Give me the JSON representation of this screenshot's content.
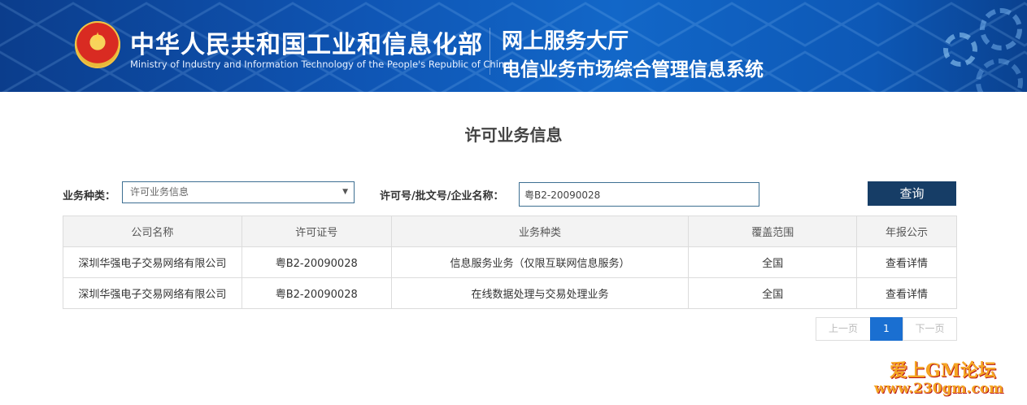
{
  "header": {
    "ministry_cn": "中华人民共和国工业和信息化部",
    "ministry_en": "Ministry of Industry and Information Technology of the People's Republic of China",
    "hall": "网上服务大厅",
    "system": "电信业务市场综合管理信息系统",
    "brand_color": "#0f55b4"
  },
  "page_title": "许可业务信息",
  "search": {
    "category_label": "业务种类：",
    "category_value": "许可业务信息",
    "keyword_label": "许可号/批文号/企业名称：",
    "keyword_value": "粤B2-20090028",
    "query_button": "查询",
    "button_color": "#163d66"
  },
  "table": {
    "headers": [
      "公司名称",
      "许可证号",
      "业务种类",
      "覆盖范围",
      "年报公示"
    ],
    "rows": [
      {
        "company": "深圳华强电子交易网络有限公司",
        "license": "粤B2-20090028",
        "business": "信息服务业务（仅限互联网信息服务）",
        "coverage": "全国",
        "report": "查看详情"
      },
      {
        "company": "深圳华强电子交易网络有限公司",
        "license": "粤B2-20090028",
        "business": "在线数据处理与交易处理业务",
        "coverage": "全国",
        "report": "查看详情"
      }
    ]
  },
  "pagination": {
    "prev": "上一页",
    "current": "1",
    "next": "下一页",
    "active_color": "#1a6fd1"
  },
  "watermark": {
    "line1": "爱上GM论坛",
    "line2": "www.230gm.com"
  }
}
